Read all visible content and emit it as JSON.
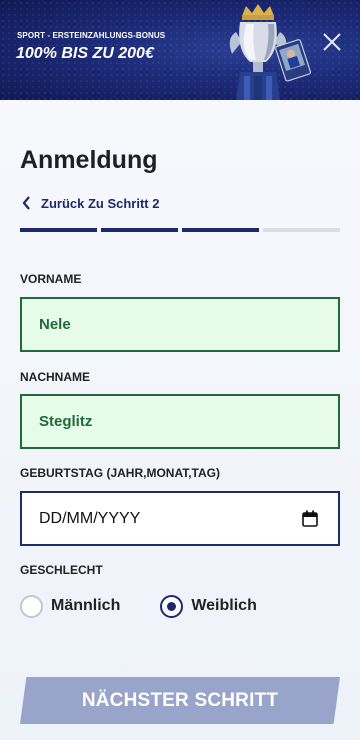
{
  "banner": {
    "subtitle": "SPORT - ERSTEINZAHLUNGS-BONUS",
    "title": "100% BIS ZU 200€",
    "close_icon": "close-icon",
    "image": "trophy-image"
  },
  "form": {
    "title": "Anmeldung",
    "back_label": "Zurück Zu Schritt 2",
    "progress": {
      "total_steps": 4,
      "completed_steps": 3
    },
    "colors": {
      "accent": "#1c2a6b",
      "valid": "#1f6b3a",
      "valid_bg": "#e6fce9",
      "button_disabled": "#98a4c9"
    },
    "first_name": {
      "label": "VORNAME",
      "value": "Nele"
    },
    "last_name": {
      "label": "NACHNAME",
      "value": "Steglitz"
    },
    "birthday": {
      "label": "GEBURTSTAG (JAHR,MONAT,TAG)",
      "placeholder": "DD/MM/YYYY"
    },
    "gender": {
      "label": "GESCHLECHT",
      "options": [
        {
          "label": "Männlich",
          "selected": false
        },
        {
          "label": "Weiblich",
          "selected": true
        }
      ]
    },
    "next_label": "NÄCHSTER SCHRITT"
  }
}
